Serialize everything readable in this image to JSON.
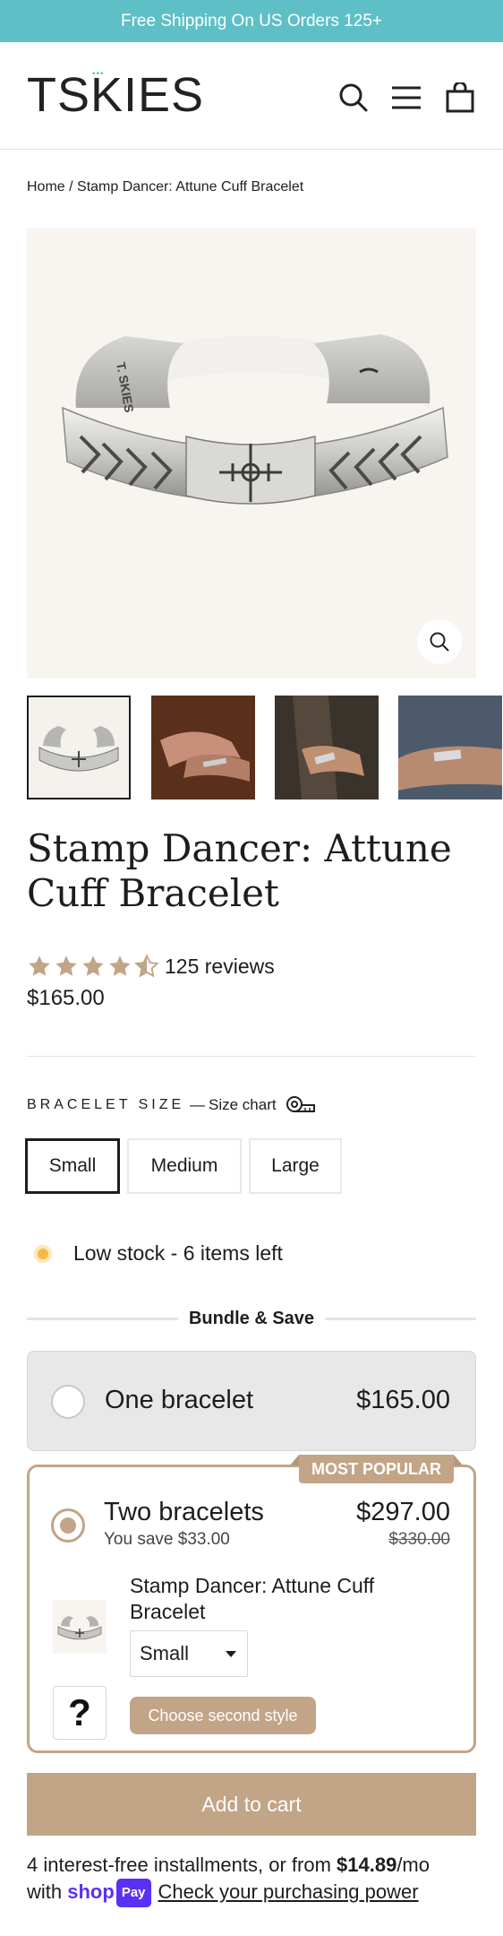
{
  "announcement": "Free Shipping On US Orders 125+",
  "brand": {
    "logo_text": "TSKIES",
    "accent": "#5fbfc6"
  },
  "header_icons": [
    "search-icon",
    "menu-icon",
    "cart-icon"
  ],
  "breadcrumb": {
    "home": "Home",
    "separator": " / ",
    "current": "Stamp Dancer: Attune Cuff Bracelet"
  },
  "product": {
    "title": "Stamp Dancer: Attune Cuff Bracelet",
    "rating": 4.5,
    "reviews": "125 reviews",
    "price": "$165.00",
    "engraving": "T. SKIES",
    "thumbnails": [
      "cuff-bracelet-front",
      "hands-wearing-bracelet",
      "man-wearing-bracelet",
      "wrist-with-bracelet"
    ]
  },
  "size": {
    "label": "BRACELET SIZE",
    "chart_dash": "—",
    "chart_label": "Size chart",
    "options": [
      "Small",
      "Medium",
      "Large"
    ],
    "selected": "Small"
  },
  "stock": {
    "text": "Low stock - 6 items left",
    "color": "#f5b944"
  },
  "bundle": {
    "heading": "Bundle & Save",
    "option1": {
      "name": "One bracelet",
      "price": "$165.00",
      "selected": false
    },
    "option2": {
      "badge": "MOST POPULAR",
      "name": "Two bracelets",
      "savings": "You save $33.00",
      "price": "$297.00",
      "compare_price": "$330.00",
      "selected": true,
      "item_name": "Stamp Dancer: Attune Cuff Bracelet",
      "item_size": "Small",
      "placeholder": "?",
      "second_button": "Choose second style"
    },
    "accent": "#c2a487"
  },
  "add_to_cart": "Add to cart",
  "installments": {
    "prefix": "4 interest-free installments, or from ",
    "amount": "$14.89",
    "suffix": "/mo",
    "with": "with ",
    "shop": "shop",
    "pay": "Pay",
    "link": "Check your purchasing power",
    "shop_color": "#5a31f4"
  }
}
